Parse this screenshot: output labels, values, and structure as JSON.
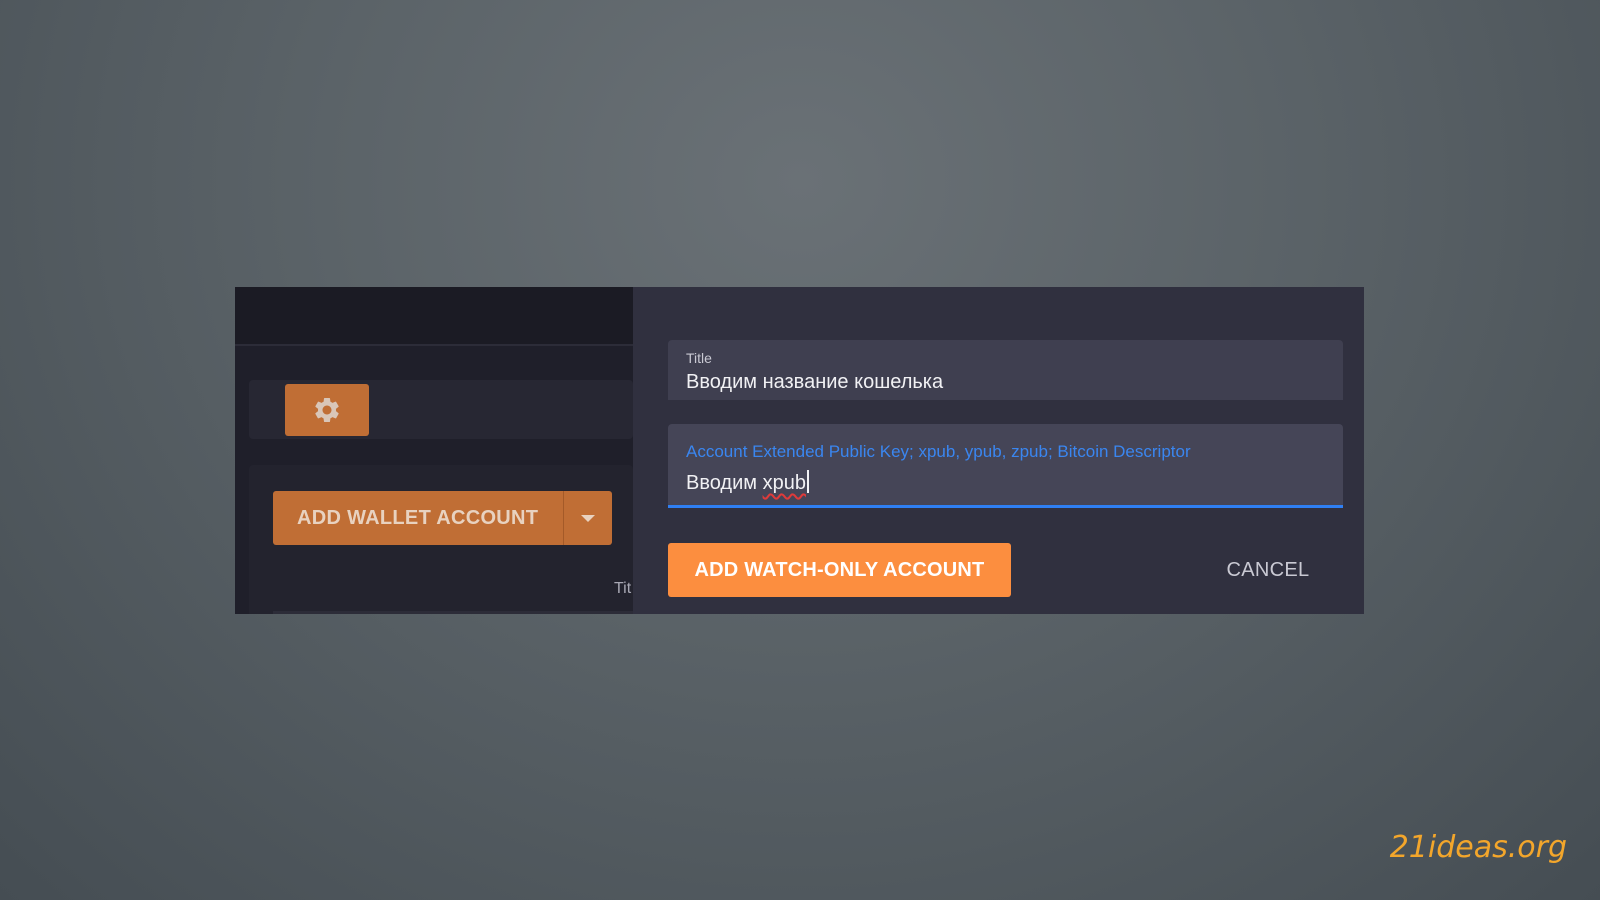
{
  "background_app": {
    "settings_icon": "gear-icon",
    "add_wallet_label": "ADD WALLET ACCOUNT",
    "dropdown_icon": "caret-down-icon",
    "title_fragment": "Tit"
  },
  "dialog": {
    "title_field": {
      "label": "Title",
      "value": "Вводим название кошелька"
    },
    "xpub_field": {
      "label": "Account Extended Public Key; xpub, ypub, zpub; Bitcoin Descriptor",
      "value_prefix": "Вводим ",
      "value_misspelled": "xpub"
    },
    "add_button": "ADD WATCH-ONLY ACCOUNT",
    "cancel_button": "CANCEL"
  },
  "watermark": "21ideas.org",
  "colors": {
    "accent_orange": "#fc8e3f",
    "background_orange": "#c06e35",
    "focus_blue": "#2f7ff3",
    "watermark": "#f3a62b"
  }
}
